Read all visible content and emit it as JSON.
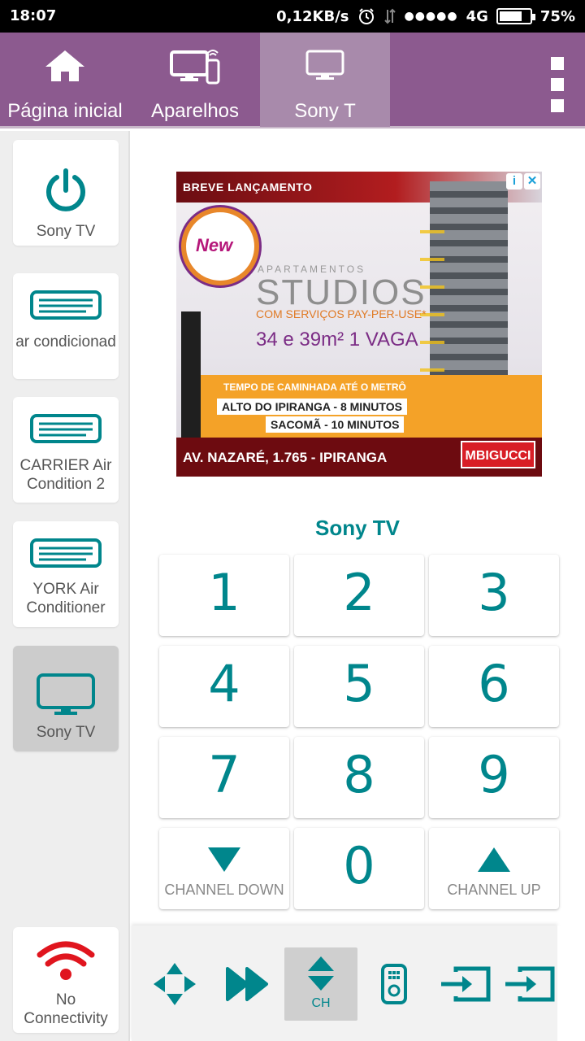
{
  "status_bar": {
    "time": "18:07",
    "net_speed": "0,12KB/s",
    "signal_dots": "●●●●●",
    "network": "4G",
    "battery": "75%",
    "battery_level": 0.75
  },
  "tabs": [
    {
      "label": "Página inicial",
      "icon": "home-icon"
    },
    {
      "label": "Aparelhos",
      "icon": "devices-icon"
    },
    {
      "label": "Sony T",
      "icon": "tv-icon",
      "active": true
    }
  ],
  "devices": [
    {
      "label": "Sony TV",
      "icon": "power-icon"
    },
    {
      "label": "ar condicionad",
      "icon": "air-conditioner-icon"
    },
    {
      "label": "CARRIER Air Condition 2",
      "icon": "air-conditioner-icon"
    },
    {
      "label": "YORK Air Conditioner",
      "icon": "air-conditioner-icon"
    },
    {
      "label": "Sony TV",
      "icon": "tv-icon",
      "selected": true
    }
  ],
  "connectivity": {
    "label": "No Connectivity",
    "icon": "wifi-icon",
    "color": "#e0151e"
  },
  "ad": {
    "header": "BREVE LANÇAMENTO",
    "badge": "New",
    "small": "APARTAMENTOS",
    "headline": "STUDIOS",
    "services": "COM SERVIÇOS PAY-PER-USE*",
    "sizes": "34 e 39m² 1 VAGA",
    "walk_title": "TEMPO DE CAMINHADA ATÉ O METRÔ",
    "walk_1": "ALTO DO IPIRANGA - 8 MINUTOS",
    "walk_2": "SACOMÃ - 10 MINUTOS",
    "address": "AV. NAZARÉ, 1.765 - IPIRANGA",
    "logo": "MBIGUCCI",
    "info": "i",
    "close": "✕"
  },
  "remote": {
    "device_title": "Sony TV",
    "keys": [
      "1",
      "2",
      "3",
      "4",
      "5",
      "6",
      "7",
      "8",
      "9"
    ],
    "zero": "0",
    "channel_down": "CHANNEL DOWN",
    "channel_up": "CHANNEL UP"
  },
  "bottom_controls": {
    "ch_label": "CH"
  },
  "colors": {
    "accent": "#00868c",
    "tabbar": "#8c5a8f",
    "tab_active": "#a88aab",
    "error": "#e0151e"
  }
}
